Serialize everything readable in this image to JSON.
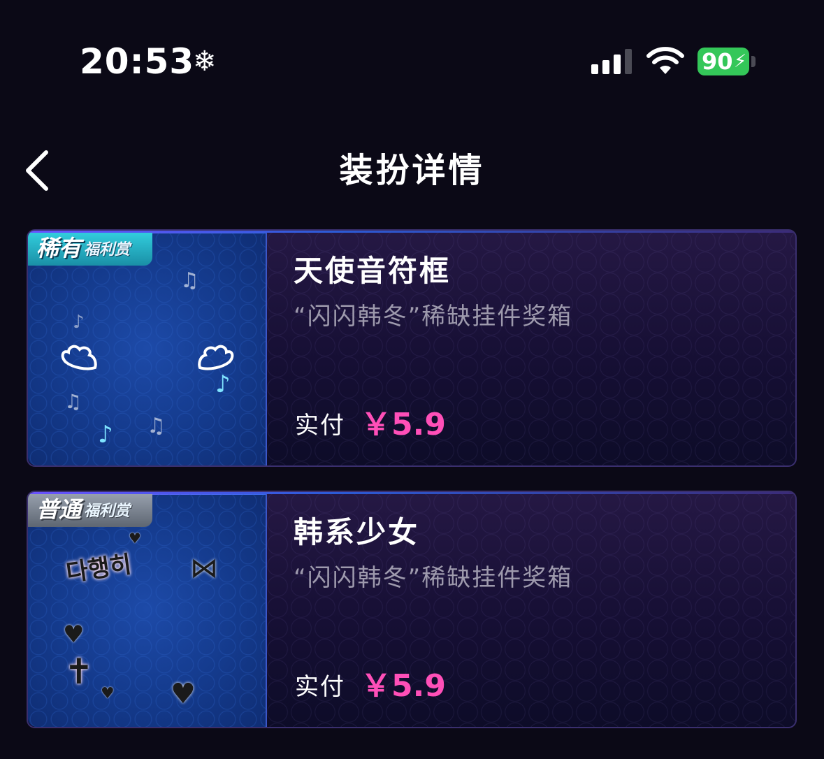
{
  "status_bar": {
    "time": "20:53",
    "snow_icon": "❄",
    "battery_level": "90",
    "battery_color": "#34c759"
  },
  "header": {
    "title": "装扮详情",
    "back_icon": "chevron-left-icon"
  },
  "items": [
    {
      "badge_main": "稀有",
      "badge_sub": "福利赏",
      "badge_color": "#33d1e0",
      "name": "天使音符框",
      "source": "“闪闪韩冬”稀缺挂件奖箱",
      "price_label": "实付",
      "price": "￥5.9"
    },
    {
      "badge_main": "普通",
      "badge_sub": "福利赏",
      "badge_color": "#9aa3b0",
      "name": "韩系少女",
      "source": "“闪闪韩冬”稀缺挂件奖箱",
      "price_label": "实付",
      "price": "￥5.9"
    }
  ],
  "accent_color": "#ff4fb8"
}
